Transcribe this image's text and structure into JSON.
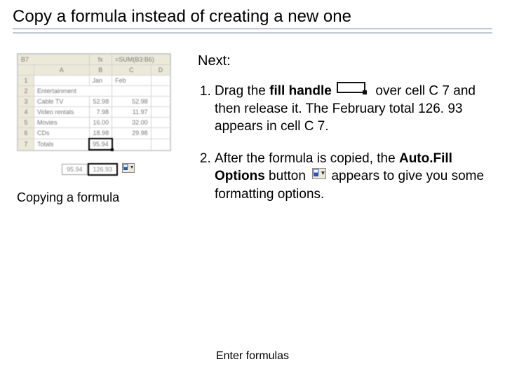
{
  "title": "Copy a formula instead of creating a new one",
  "caption": "Copying a formula",
  "next_label": "Next:",
  "steps": {
    "s1_a": "Drag the ",
    "s1_b": "fill handle",
    "s1_c": " over cell C 7 and then release it. The February total 126. 93 appears in cell C 7.",
    "s2_a": "After the formula is copied, the ",
    "s2_b": "Auto.Fill Options",
    "s2_c": " button ",
    "s2_d": "appears to give you some formatting options."
  },
  "icons": {
    "fill_handle": "fill-handle-icon",
    "autofill_button": "autofill-options-icon"
  },
  "footer": "Enter formulas",
  "spreadsheet": {
    "name_box": "B7",
    "formula_bar": "=SUM(B3:B6)",
    "columns": [
      "A",
      "B",
      "C",
      "D"
    ],
    "rows": [
      {
        "n": "1",
        "cells": [
          "",
          "Jan",
          "Feb",
          ""
        ]
      },
      {
        "n": "2",
        "cells": [
          "Entertainment",
          "",
          "",
          ""
        ]
      },
      {
        "n": "3",
        "cells": [
          "Cable TV",
          "52.98",
          "52.98",
          ""
        ]
      },
      {
        "n": "4",
        "cells": [
          "Video rentals",
          "7.98",
          "11.97",
          ""
        ]
      },
      {
        "n": "5",
        "cells": [
          "Movies",
          "16.00",
          "32.00",
          ""
        ]
      },
      {
        "n": "6",
        "cells": [
          "CDs",
          "18.98",
          "29.98",
          ""
        ]
      },
      {
        "n": "7",
        "cells": [
          "Totals",
          "95.94",
          "",
          ""
        ]
      }
    ],
    "result_cells": [
      "95.94",
      "126.93"
    ]
  }
}
